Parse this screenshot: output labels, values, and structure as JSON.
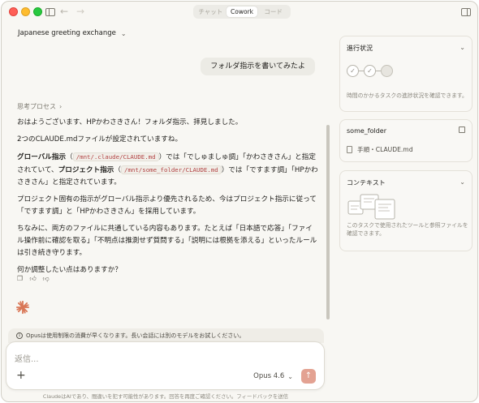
{
  "titlebar": {
    "modes": [
      "チャット",
      "Cowork",
      "コード"
    ],
    "active_mode": "Cowork"
  },
  "conversation": {
    "title": "Japanese greeting exchange",
    "user_message": "フォルダ指示を書いてみたよ",
    "thinking_label": "思考プロセス",
    "answer": {
      "p1": "おはようございます、HPかわさきさん！フォルダ指示、拝見しました。",
      "p2": "2つのCLAUDE.mdファイルが設定されていますね。",
      "p3": {
        "global_label": "グローバル指示",
        "open_paren": "（",
        "global_path": "/mnt/.claude/CLAUDE.md",
        "mid1": "）では「でしゅましゅ調」「かわさきさん」と指定されていて、",
        "project_label": "プロジェクト指示",
        "project_path": "/mnt/some_folder/CLAUDE.md",
        "mid2": "）では「ですます調」「HPかわさきさん」と指定されています。"
      },
      "p4": "プロジェクト固有の指示がグローバル指示より優先されるため、今はプロジェクト指示に従って「ですます調」と「HPかわさきさん」を採用しています。",
      "p5": "ちなみに、両方のファイルに共通している内容もあります。たとえば「日本語で応答」「ファイル操作前に確認を取る」「不明点は推測せず質問する」「説明には根拠を添える」といったルールは引き続き守ります。",
      "p6": "何か調整したい点はありますか？"
    }
  },
  "notice": {
    "text": "Opusは使用制限の消費が早くなります。長い会話には別のモデルをお試しください。"
  },
  "composer": {
    "placeholder": "返信...",
    "model": "Opus 4.6"
  },
  "footer": {
    "disclaimer": "ClaudeはAIであり、間違いを犯す可能性があります。回答を再度ご確認ください。フィードバックを送信"
  },
  "right_panel": {
    "progress": {
      "title": "進行状況",
      "description": "時間のかかるタスクの進捗状況を確認できます。"
    },
    "folder": {
      "title": "some_folder",
      "file": "手順・CLAUDE.md"
    },
    "context": {
      "title": "コンテキスト",
      "description": "このタスクで使用されたツールと参照ファイルを確認できます。"
    }
  },
  "colors": {
    "accent": "#d97757",
    "send_button": "#e3a292",
    "code_text": "#b24343"
  }
}
